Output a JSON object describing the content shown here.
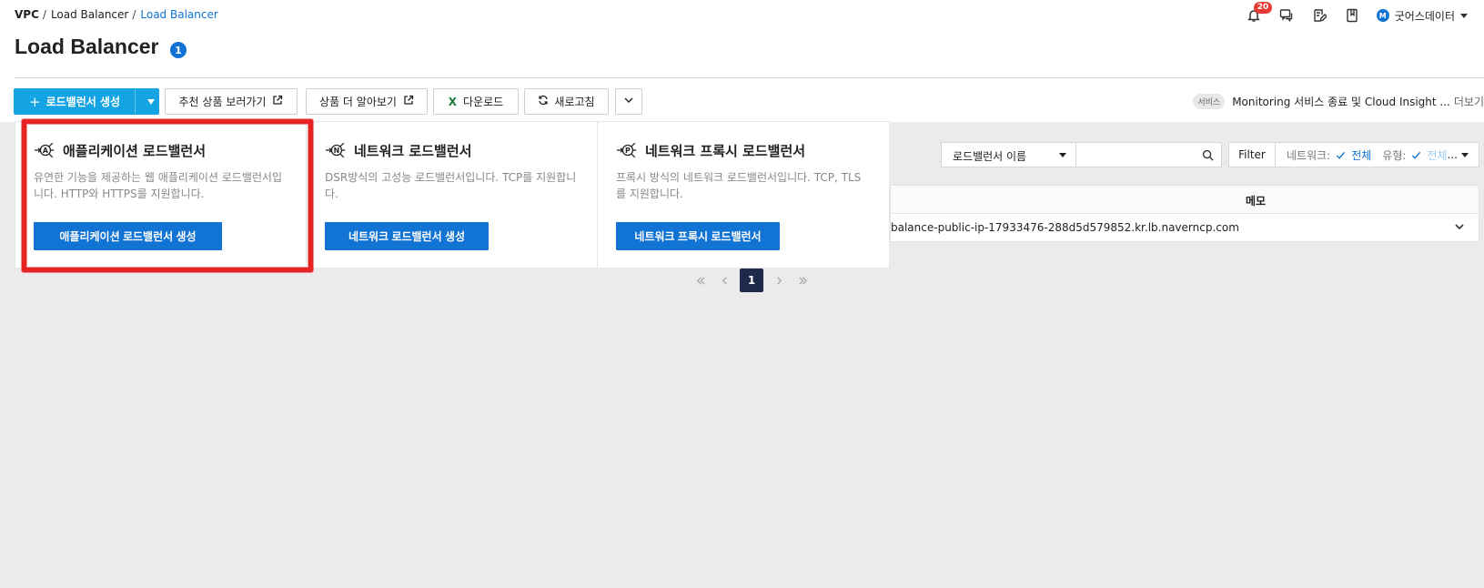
{
  "breadcrumb": [
    "VPC",
    "Load Balancer",
    "Load Balancer"
  ],
  "header": {
    "notification_count": "20",
    "user_initial": "M",
    "user_name": "굿어스데이터",
    "icons": [
      "bell-icon",
      "chat-icon",
      "edit-doc-icon",
      "book-icon"
    ]
  },
  "page": {
    "title": "Load Balancer",
    "count": "1"
  },
  "toolbar": {
    "create": "로드밸런서 생성",
    "recommend": "추천 상품 보러가기",
    "learn_more": "상품 더 알아보기",
    "download": "다운로드",
    "refresh": "새로고침"
  },
  "notice": {
    "tag": "서비스",
    "text": "Monitoring 서비스 종료 및 Cloud Insight ...",
    "more": "더보기"
  },
  "filter": {
    "select_value": "로드밸런서 이름",
    "search_value": "",
    "filter_label": "Filter",
    "network_label": "네트워크:",
    "network_value": "전체",
    "type_label": "유형:",
    "type_value": "전체",
    "ellipsis": "..."
  },
  "table": {
    "columns": [
      "메모"
    ],
    "rows": [
      {
        "domain": "balance-public-ip-17933476-288d5d579852.kr.lb.naverncp.com"
      }
    ]
  },
  "pagination": {
    "current": "1"
  },
  "dropdown": {
    "options": [
      {
        "icon_letter": "A",
        "title": "애플리케이션 로드밸런서",
        "desc": "유연한 기능을 제공하는 웹 애플리케이션 로드밸런서입니다. HTTP와 HTTPS를 지원합니다.",
        "button": "애플리케이션 로드밸런서 생성"
      },
      {
        "icon_letter": "N",
        "title": "네트워크 로드밸런서",
        "desc": "DSR방식의 고성능 로드밸런서입니다. TCP를 지원합니다.",
        "button": "네트워크 로드밸런서 생성"
      },
      {
        "icon_letter": "P",
        "title": "네트워크 프록시 로드밸런서",
        "desc": "프록시 방식의 네트워크 로드밸런서입니다. TCP, TLS를 지원합니다.",
        "button": "네트워크 프록시 로드밸런서"
      }
    ]
  },
  "colors": {
    "primary": "#1173d4",
    "create_button": "#14a3e3",
    "highlight": "#e52424",
    "badge": "#e53935"
  }
}
